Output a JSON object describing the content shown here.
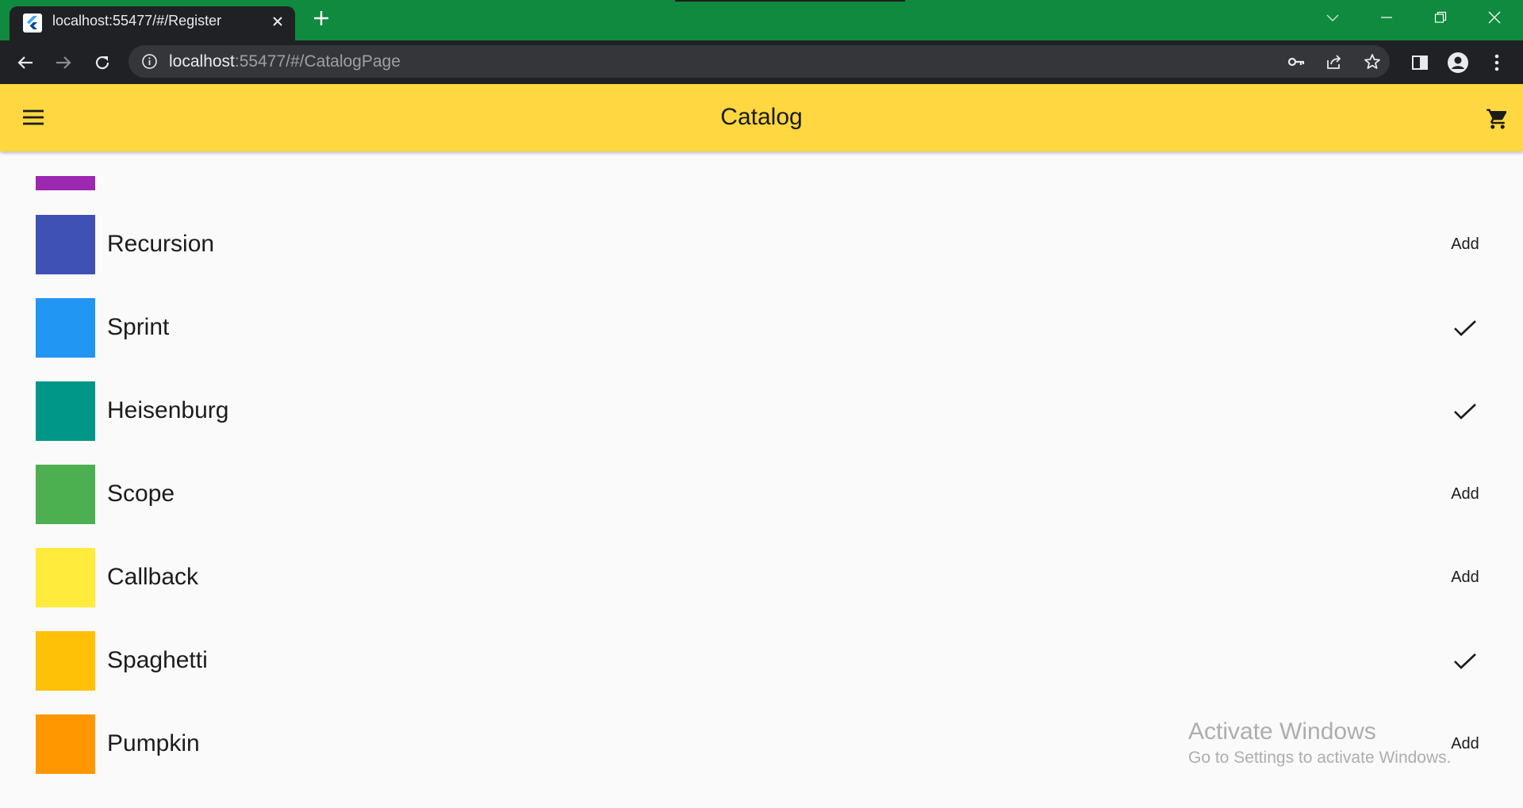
{
  "browser": {
    "tab_title": "localhost:55477/#/Register",
    "url_host": "localhost",
    "url_path": ":55477/#/CatalogPage",
    "frame_color": "#0f8a3f",
    "icons": [
      "flutter-logo-icon",
      "close-icon",
      "plus-icon",
      "chevron-down-icon",
      "minimize-icon",
      "restore-icon",
      "close-window-icon",
      "back-arrow-icon",
      "forward-arrow-icon",
      "reload-icon",
      "info-icon",
      "key-icon",
      "share-icon",
      "star-icon",
      "side-panel-icon",
      "profile-icon",
      "kebab-menu-icon"
    ]
  },
  "appbar": {
    "title": "Catalog",
    "background": "#ffd740",
    "icons": [
      "hamburger-menu-icon",
      "shopping-cart-icon"
    ]
  },
  "catalog": {
    "partial_item_color": "#9c27b0",
    "items": [
      {
        "name": "Recursion",
        "color": "#3f51b5",
        "in_cart": false,
        "action_label": "Add"
      },
      {
        "name": "Sprint",
        "color": "#2196f3",
        "in_cart": true,
        "action_label": ""
      },
      {
        "name": "Heisenburg",
        "color": "#009688",
        "in_cart": true,
        "action_label": ""
      },
      {
        "name": "Scope",
        "color": "#4caf50",
        "in_cart": false,
        "action_label": "Add"
      },
      {
        "name": "Callback",
        "color": "#ffeb3b",
        "in_cart": false,
        "action_label": "Add"
      },
      {
        "name": "Spaghetti",
        "color": "#ffc107",
        "in_cart": true,
        "action_label": ""
      },
      {
        "name": "Pumpkin",
        "color": "#ff9800",
        "in_cart": false,
        "action_label": "Add"
      }
    ]
  },
  "watermark": {
    "line1": "Activate Windows",
    "line2": "Go to Settings to activate Windows."
  }
}
